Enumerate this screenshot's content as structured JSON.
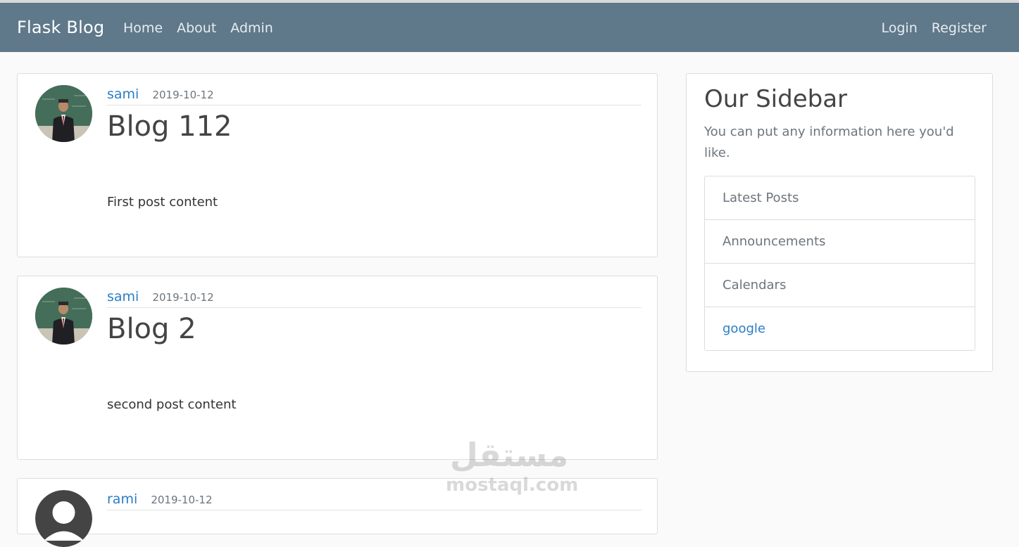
{
  "navbar": {
    "brand": "Flask Blog",
    "left_links": [
      "Home",
      "About",
      "Admin"
    ],
    "right_links": [
      "Login",
      "Register"
    ]
  },
  "posts": [
    {
      "author": "sami",
      "date": "2019-10-12",
      "title": "Blog 112",
      "content": "First post content",
      "avatar": "user-photo"
    },
    {
      "author": "sami",
      "date": "2019-10-12",
      "title": "Blog 2",
      "content": "second post content",
      "avatar": "user-photo"
    },
    {
      "author": "rami",
      "date": "2019-10-12",
      "title": "",
      "content": "",
      "avatar": "default-avatar-icon"
    }
  ],
  "sidebar": {
    "title": "Our Sidebar",
    "text": "You can put any information here you'd like.",
    "items": [
      "Latest Posts",
      "Announcements",
      "Calendars",
      "google"
    ]
  },
  "watermark": {
    "arabic": "مستقل",
    "latin": "mostaql.com"
  },
  "colors": {
    "navbar": "#5f788a",
    "link": "#2b7dc4",
    "background": "#fafafa"
  }
}
